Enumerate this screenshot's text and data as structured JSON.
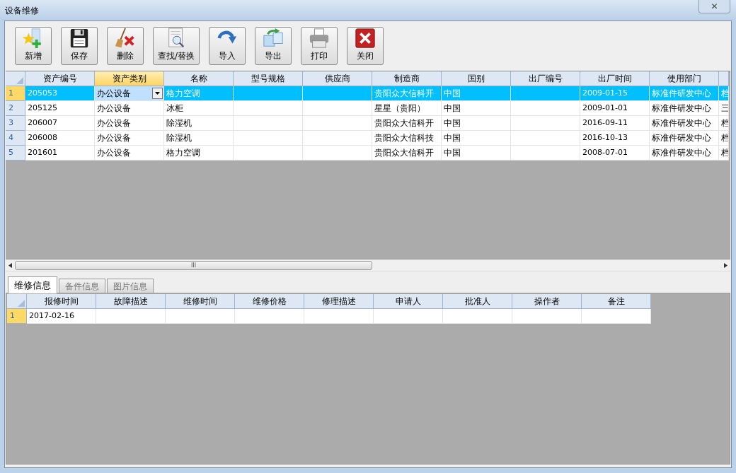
{
  "window": {
    "title": "设备维修",
    "close": "✕"
  },
  "toolbar": {
    "buttons": [
      {
        "label": "新增",
        "kind": "add"
      },
      {
        "label": "保存",
        "kind": "save"
      },
      {
        "label": "删除",
        "kind": "delete"
      },
      {
        "label": "查找/替换",
        "kind": "find"
      },
      {
        "label": "导入",
        "kind": "import"
      },
      {
        "label": "导出",
        "kind": "export"
      },
      {
        "label": "打印",
        "kind": "print"
      },
      {
        "label": "关闭",
        "kind": "close"
      }
    ]
  },
  "grid": {
    "columns": [
      {
        "label": "资产编号",
        "selected": false
      },
      {
        "label": "资产类别",
        "selected": true
      },
      {
        "label": "名称",
        "selected": false
      },
      {
        "label": "型号规格",
        "selected": false
      },
      {
        "label": "供应商",
        "selected": false
      },
      {
        "label": "制造商",
        "selected": false
      },
      {
        "label": "国别",
        "selected": false
      },
      {
        "label": "出厂编号",
        "selected": false
      },
      {
        "label": "出厂时间",
        "selected": false
      },
      {
        "label": "使用部门",
        "selected": false
      },
      {
        "selected": false
      }
    ],
    "rows": [
      {
        "number": "1",
        "selected": true,
        "cells": [
          "205053",
          "办公设备",
          "格力空调",
          "",
          "",
          "贵阳众大信科开",
          "中国",
          "",
          "2009-01-15",
          "标准件研发中心",
          "档"
        ]
      },
      {
        "number": "2",
        "selected": false,
        "cells": [
          "205125",
          "办公设备",
          "冰柜",
          "",
          "",
          "星星（贵阳）",
          "中国",
          "",
          "2009-01-01",
          "标准件研发中心",
          "三"
        ]
      },
      {
        "number": "3",
        "selected": false,
        "cells": [
          "206007",
          "办公设备",
          "除湿机",
          "",
          "",
          "贵阳众大信科开",
          "中国",
          "",
          "2016-09-11",
          "标准件研发中心",
          "档"
        ]
      },
      {
        "number": "4",
        "selected": false,
        "cells": [
          "206008",
          "办公设备",
          "除湿机",
          "",
          "",
          "贵阳众大信科技",
          "中国",
          "",
          "2016-10-13",
          "标准件研发中心",
          "档"
        ]
      },
      {
        "number": "5",
        "selected": false,
        "cells": [
          "201601",
          "办公设备",
          "格力空调",
          "",
          "",
          "贵阳众大信科开",
          "中国",
          "",
          "2008-07-01",
          "标准件研发中心",
          "档"
        ]
      }
    ],
    "scroll_thumb": "III"
  },
  "tabs": [
    {
      "label": "维修信息",
      "selected": true
    },
    {
      "label": "备件信息",
      "selected": false
    },
    {
      "label": "图片信息",
      "selected": false
    }
  ],
  "detail_grid": {
    "columns": [
      "报修时间",
      "故障描述",
      "维修时间",
      "维修价格",
      "修理描述",
      "申请人",
      "批准人",
      "操作者",
      "备注"
    ],
    "rows": [
      {
        "number": "1",
        "selected": true,
        "cells": [
          "2017-02-16",
          "",
          "",
          "",
          "",
          "",
          "",
          "",
          ""
        ]
      }
    ]
  }
}
